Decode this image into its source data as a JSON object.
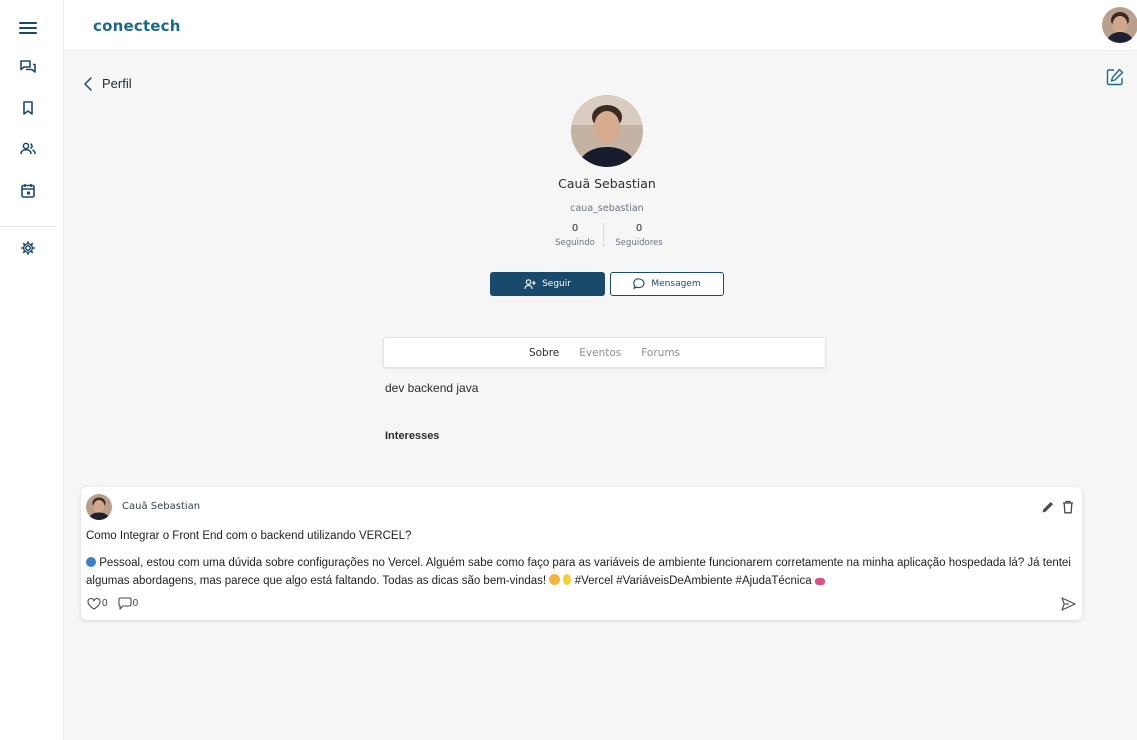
{
  "app": {
    "logo": "conectech"
  },
  "sidebar": {
    "items": [
      {
        "name": "menu",
        "icon": "hamburger-menu-icon"
      },
      {
        "name": "forums",
        "icon": "chat-bubbles-icon"
      },
      {
        "name": "saved",
        "icon": "bookmark-icon"
      },
      {
        "name": "people",
        "icon": "users-icon"
      },
      {
        "name": "events",
        "icon": "calendar-icon"
      },
      {
        "name": "settings",
        "icon": "gear-icon"
      }
    ]
  },
  "header": {
    "back_label": "Perfil"
  },
  "profile": {
    "name": "Cauã Sebastian",
    "username": "caua_sebastian",
    "following_count": "0",
    "following_label": "Seguindo",
    "followers_count": "0",
    "followers_label": "Seguidores",
    "follow_label": "Seguir",
    "message_label": "Mensagem"
  },
  "tabs": [
    {
      "label": "Sobre",
      "active": true
    },
    {
      "label": "Eventos",
      "active": false
    },
    {
      "label": "Forums",
      "active": false
    }
  ],
  "about": {
    "bio": "dev backend java",
    "interests_heading": "Interesses"
  },
  "post": {
    "author": "Cauã Sebastian",
    "title": "Como Integrar o Front End com o backend utilizando VERCEL?",
    "body": "Pessoal, estou com uma dúvida sobre configurações no Vercel. Alguém sabe como faço para as variáveis de ambiente funcionarem corretamente na minha aplicação hospedada lá? Já tentei algumas abordagens, mas parece que algo está faltando. Todas as dicas são bem-vindas!",
    "hashtags": "#Vercel #VariáveisDeAmbiente #AjudaTécnica",
    "likes": "0",
    "comments": "0"
  },
  "colors": {
    "accent": "#1a4a6b",
    "logo": "#1e6a86",
    "background": "#f6f6f6"
  }
}
